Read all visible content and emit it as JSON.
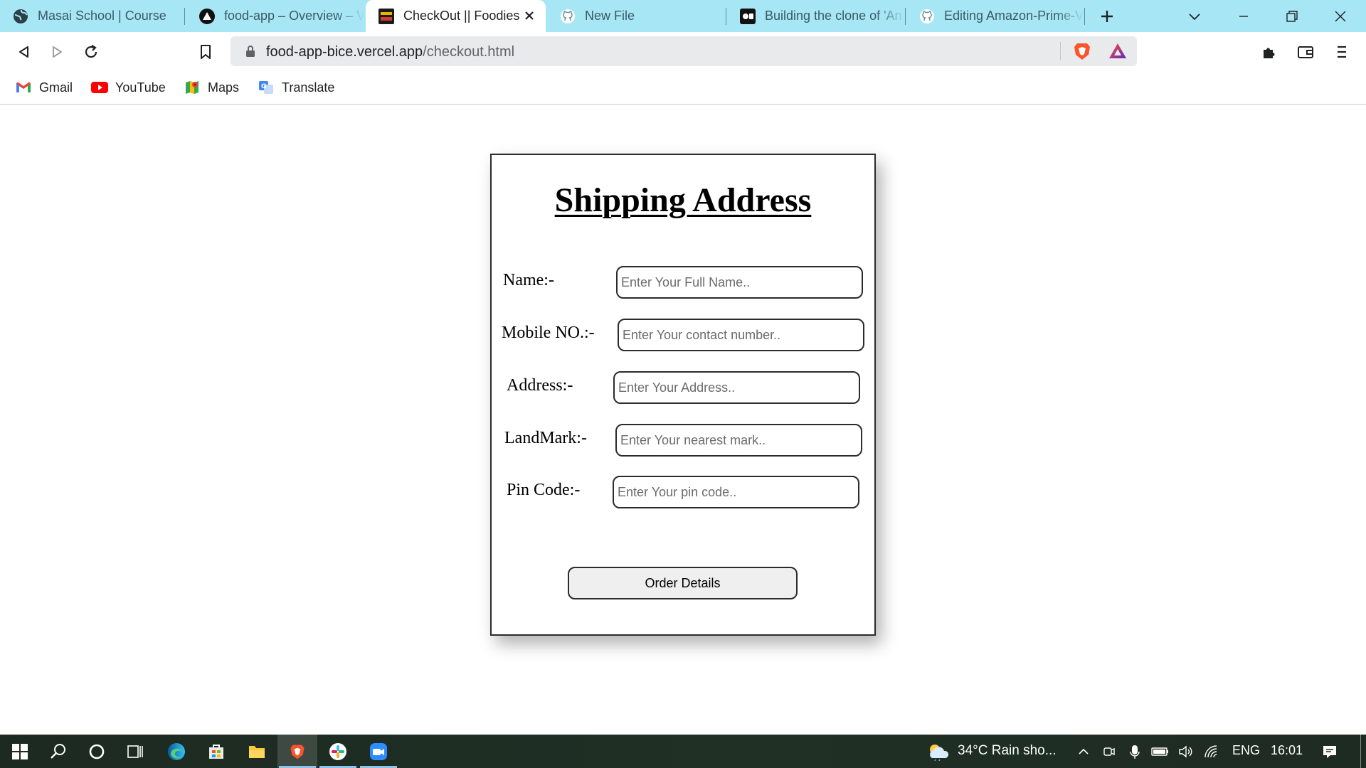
{
  "browser": {
    "tabs": [
      {
        "title": "Masai School | Course",
        "icon": "globe-icon"
      },
      {
        "title": "food-app – Overview – V",
        "icon": "vercel-icon"
      },
      {
        "title": "CheckOut || Foodies",
        "icon": "foodies-icon",
        "active": true
      },
      {
        "title": "New File",
        "icon": "github-icon"
      },
      {
        "title": "Building the clone of 'An",
        "icon": "video-icon"
      },
      {
        "title": "Editing Amazon-Prime-V",
        "icon": "github-icon"
      }
    ],
    "url": {
      "domain": "food-app-bice.vercel.app",
      "path": "/checkout.html"
    },
    "bookmarks": [
      {
        "label": "Gmail",
        "icon": "gmail-icon"
      },
      {
        "label": "YouTube",
        "icon": "youtube-icon"
      },
      {
        "label": "Maps",
        "icon": "maps-icon"
      },
      {
        "label": "Translate",
        "icon": "translate-icon"
      }
    ]
  },
  "page": {
    "heading": "Shipping Address",
    "fields": [
      {
        "label": "Name:-",
        "placeholder": "Enter Your Full Name.."
      },
      {
        "label": "Mobile NO.:-",
        "placeholder": "Enter Your contact number.."
      },
      {
        "label": "Address:-",
        "placeholder": "Enter Your Address.."
      },
      {
        "label": "LandMark:-",
        "placeholder": "Enter Your nearest mark.."
      },
      {
        "label": "Pin Code:-",
        "placeholder": "Enter Your pin code.."
      }
    ],
    "submit_label": "Order Details"
  },
  "taskbar": {
    "weather": "34°C  Rain sho...",
    "language": "ENG",
    "time": "16:01"
  },
  "colors": {
    "tab_strip": "#a6e6f5",
    "brave_orange": "#fb542b",
    "taskbar": "#1d2a22"
  }
}
